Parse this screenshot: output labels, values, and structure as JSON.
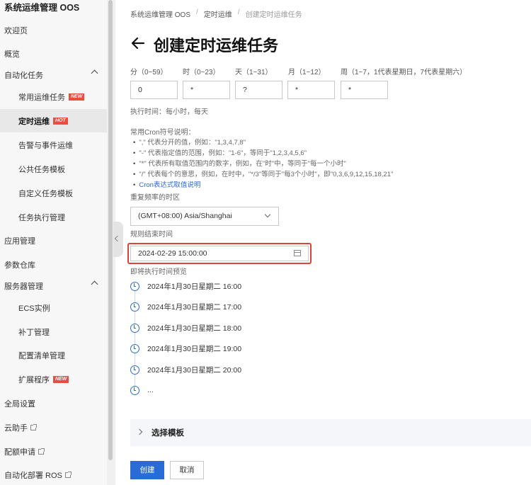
{
  "sidebar": {
    "title": "系统运维管理 OOS",
    "items": [
      {
        "label": "欢迎页"
      },
      {
        "label": "概览"
      },
      {
        "label": "自动化任务"
      },
      {
        "label": "常用运维任务",
        "badge": "NEW"
      },
      {
        "label": "定时运维",
        "badge": "HOT"
      },
      {
        "label": "告警与事件运维"
      },
      {
        "label": "公共任务模板"
      },
      {
        "label": "自定义任务模板"
      },
      {
        "label": "任务执行管理"
      },
      {
        "label": "应用管理"
      },
      {
        "label": "参数仓库"
      },
      {
        "label": "服务器管理"
      },
      {
        "label": "ECS实例"
      },
      {
        "label": "补丁管理"
      },
      {
        "label": "配置清单管理"
      },
      {
        "label": "扩展程序",
        "badge": "NEW"
      },
      {
        "label": "全局设置"
      },
      {
        "label": "云助手"
      },
      {
        "label": "配额申请"
      },
      {
        "label": "自动化部署 ROS"
      }
    ]
  },
  "breadcrumb": [
    "系统运维管理 OOS",
    "定时运维",
    "创建定时运维任务"
  ],
  "page_title": "创建定时运维任务",
  "cron": {
    "labels": [
      "分（0~59）",
      "时（0~23）",
      "天（1~31）",
      "月（1~12）",
      "周（1~7，1代表星期日，7代表星期六）"
    ],
    "values": [
      "0",
      "*",
      "?",
      "*",
      "*"
    ]
  },
  "exec_time": "执行时间：每小时，每天",
  "cron_help": {
    "title": "常用Cron符号说明：",
    "lines": [
      "\",\" 代表分开的值，例如：\"1,3,4,7,8\"",
      "\"-\" 代表指定值的范围，例如：\"1-6\"，等同于\"1,2,3,4,5,6\"",
      "\"*\" 代表所有取值范围内的数字，例如，在\"时\"中，等同于\"每一个小时\"",
      "\"/\" 代表每个的意思，例如，在时中，\"*/3\"等同于\"每3个小时\"，即\"0,3,6,9,12,15,18,21\""
    ],
    "link": "Cron表达式取值说明"
  },
  "timezone_label": "重复频率的时区",
  "timezone_value": "(GMT+08:00) Asia/Shanghai",
  "end_time_label": "规则结束时间",
  "end_time_value": "2024-02-29 15:00:00",
  "preview_label": "即将执行时间预览",
  "preview": [
    "2024年1月30日星期二 16:00",
    "2024年1月30日星期二 17:00",
    "2024年1月30日星期二 18:00",
    "2024年1月30日星期二 19:00",
    "2024年1月30日星期二 20:00",
    "..."
  ],
  "template_section": "选择模板",
  "buttons": {
    "create": "创建",
    "cancel": "取消"
  },
  "colors": {
    "primary": "#2a6bd6",
    "highlight": "#d9433b",
    "badge": "#e84e3d"
  }
}
